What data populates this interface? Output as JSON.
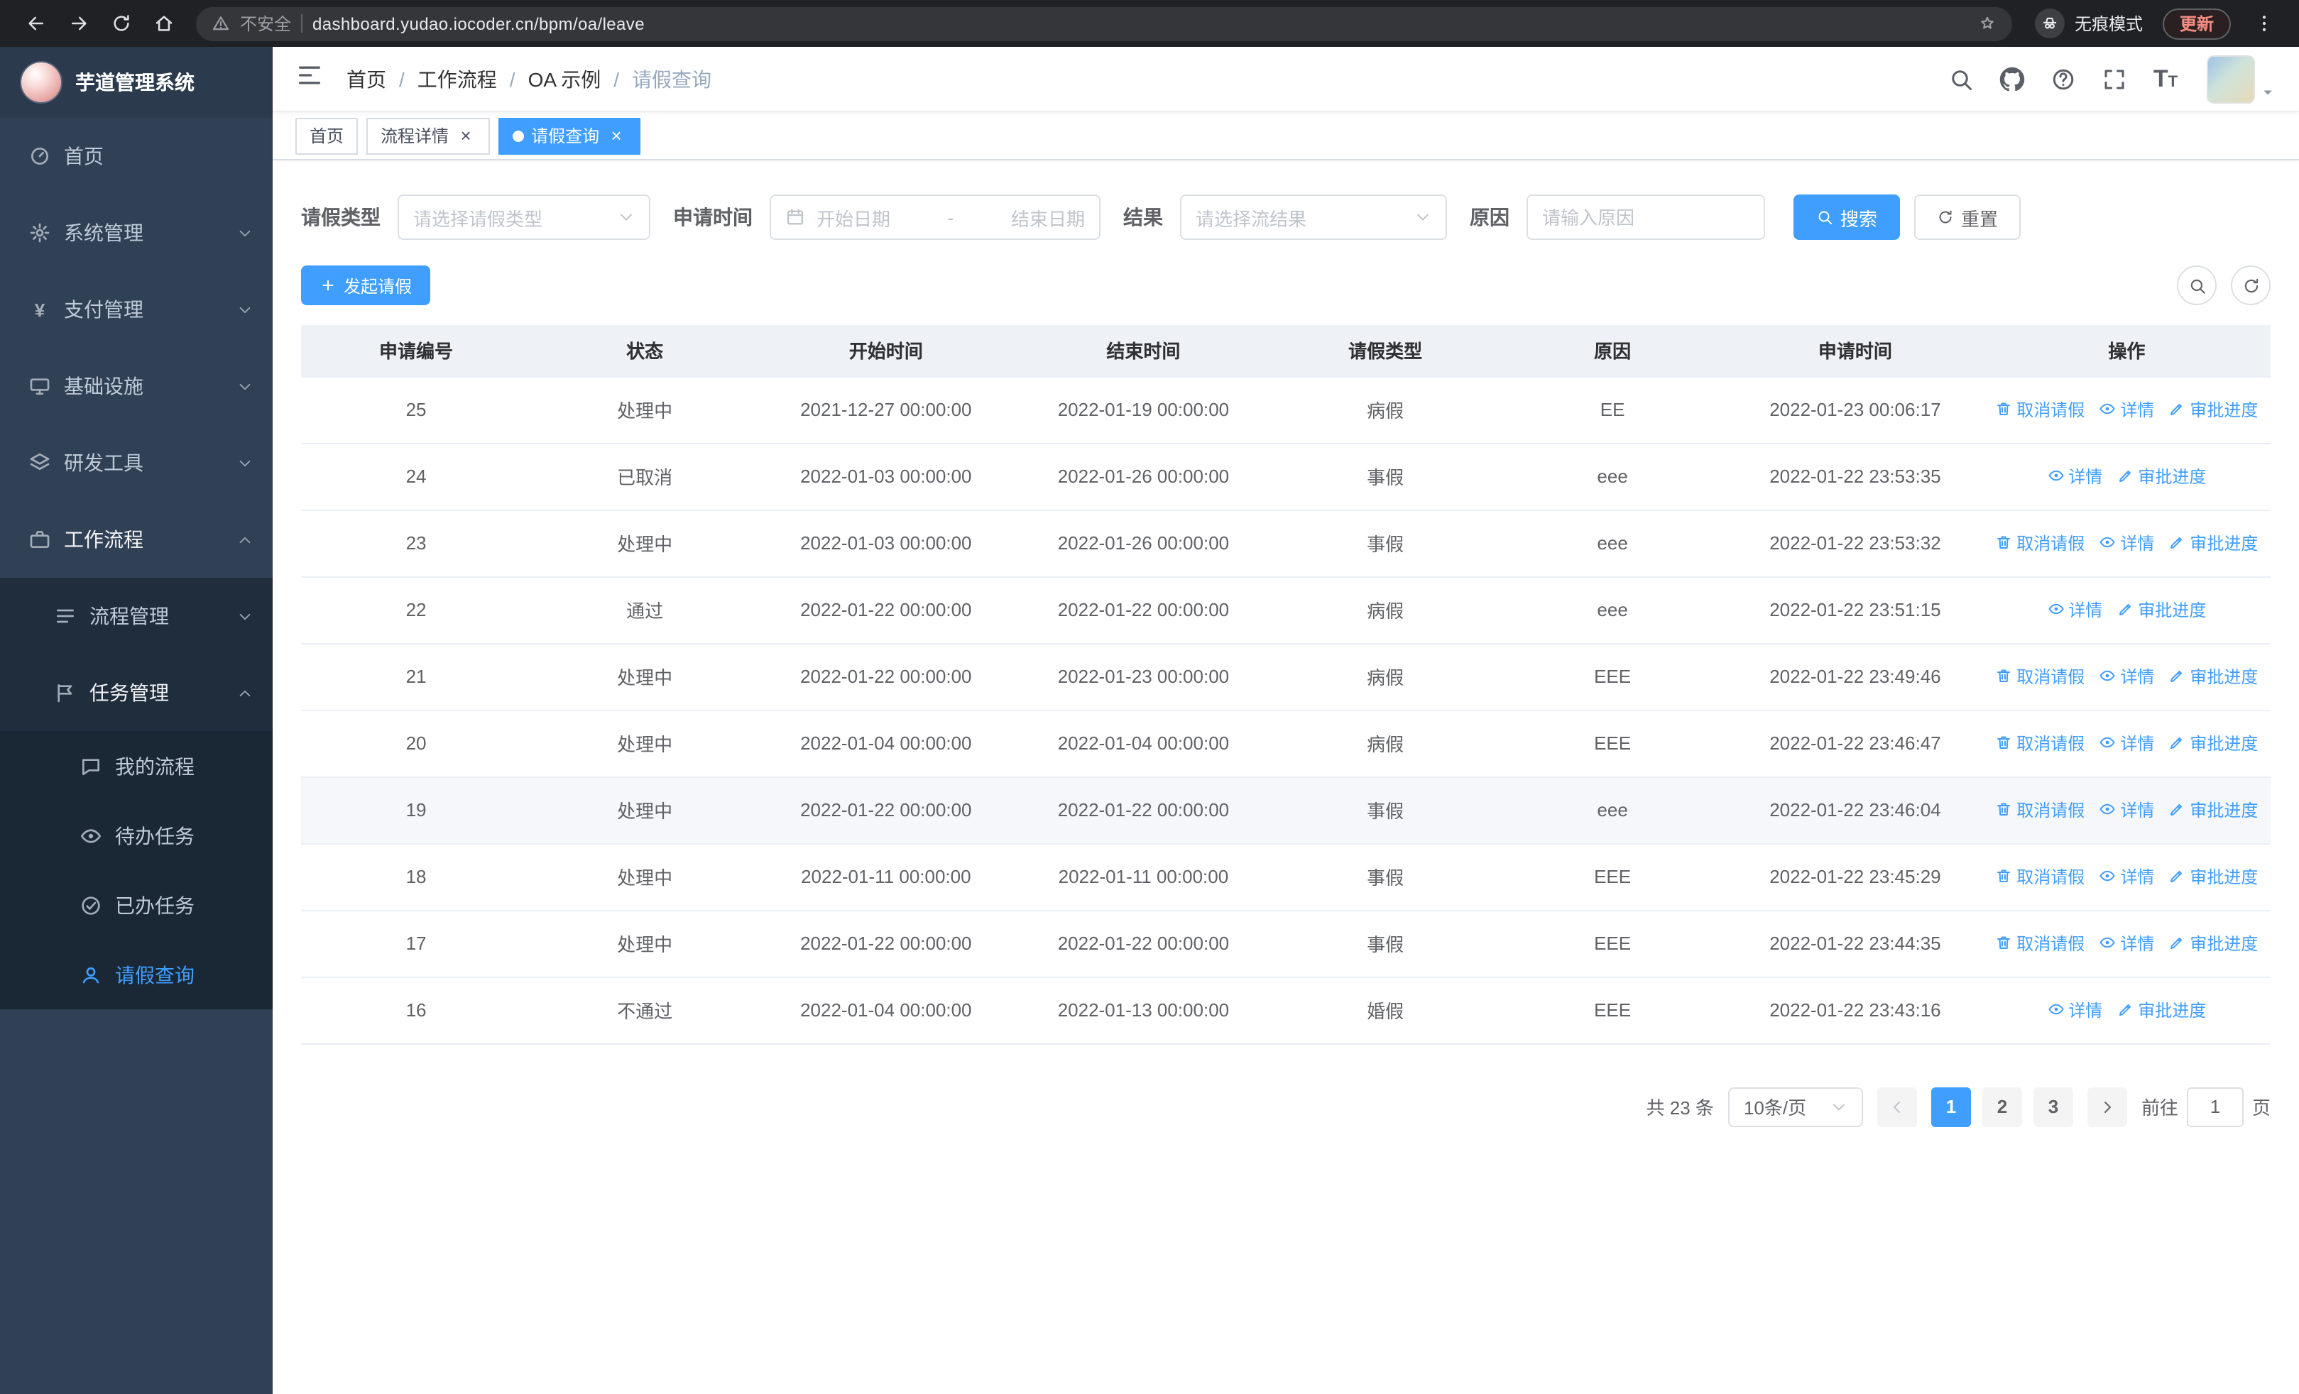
{
  "colors": {
    "accent": "#409EFF",
    "sidebar_bg": "#304156"
  },
  "browser": {
    "security_label": "不安全",
    "url": "dashboard.yudao.iocoder.cn/bpm/oa/leave",
    "incognito_label": "无痕模式",
    "update_label": "更新"
  },
  "sidebar": {
    "logo_title": "芋道管理系统",
    "items": [
      {
        "id": "home",
        "label": "首页",
        "icon": "dashboard-icon",
        "level": 1
      },
      {
        "id": "system-management",
        "label": "系统管理",
        "icon": "gear-icon",
        "level": 1,
        "chevron": "down"
      },
      {
        "id": "payment-management",
        "label": "支付管理",
        "icon": "yen-icon",
        "level": 1,
        "chevron": "down"
      },
      {
        "id": "infrastructure",
        "label": "基础设施",
        "icon": "monitor-icon",
        "level": 1,
        "chevron": "down"
      },
      {
        "id": "dev-tools",
        "label": "研发工具",
        "icon": "tools-icon",
        "level": 1,
        "chevron": "down"
      },
      {
        "id": "workflow",
        "label": "工作流程",
        "icon": "briefcase-icon",
        "level": 1,
        "chevron": "up",
        "expanded": true
      },
      {
        "id": "process-management",
        "label": "流程管理",
        "icon": "list-icon",
        "level": 2,
        "chevron": "down"
      },
      {
        "id": "task-management",
        "label": "任务管理",
        "icon": "flag-icon",
        "level": 2,
        "chevron": "up",
        "expanded": true
      },
      {
        "id": "my-process",
        "label": "我的流程",
        "icon": "chat-icon",
        "level": 3
      },
      {
        "id": "todo-task",
        "label": "待办任务",
        "icon": "eye-icon",
        "level": 3
      },
      {
        "id": "done-task",
        "label": "已办任务",
        "icon": "check-icon",
        "level": 3
      },
      {
        "id": "leave-query",
        "label": "请假查询",
        "icon": "user-icon",
        "level": 3,
        "active": true
      }
    ]
  },
  "navbar": {
    "breadcrumb": [
      "首页",
      "工作流程",
      "OA 示例",
      "请假查询"
    ],
    "action_icons": [
      "search-icon",
      "github-icon",
      "question-icon",
      "fullscreen-icon",
      "font-size-icon"
    ]
  },
  "tabs": [
    {
      "label": "首页"
    },
    {
      "label": "流程详情",
      "closable": true
    },
    {
      "label": "请假查询",
      "closable": true,
      "active": true
    }
  ],
  "filters": {
    "leave_type_label": "请假类型",
    "leave_type_placeholder": "请选择请假类型",
    "apply_time_label": "申请时间",
    "date_start_placeholder": "开始日期",
    "date_separator": "-",
    "date_end_placeholder": "结束日期",
    "result_label": "结果",
    "result_placeholder": "请选择流结果",
    "reason_label": "原因",
    "reason_placeholder": "请输入原因",
    "search_label": "搜索",
    "reset_label": "重置"
  },
  "toolbar": {
    "create_label": "发起请假",
    "icon_buttons": [
      "search-icon",
      "refresh-icon"
    ]
  },
  "table": {
    "columns": [
      "申请编号",
      "状态",
      "开始时间",
      "结束时间",
      "请假类型",
      "原因",
      "申请时间",
      "操作"
    ],
    "action_labels": {
      "cancel": "取消请假",
      "detail": "详情",
      "progress": "审批进度"
    },
    "rows": [
      {
        "id": "25",
        "status": "处理中",
        "start": "2021-12-27 00:00:00",
        "end": "2022-01-19 00:00:00",
        "type": "病假",
        "reason": "EE",
        "applied": "2022-01-23 00:06:17",
        "actions": [
          "cancel",
          "detail",
          "progress"
        ]
      },
      {
        "id": "24",
        "status": "已取消",
        "start": "2022-01-03 00:00:00",
        "end": "2022-01-26 00:00:00",
        "type": "事假",
        "reason": "eee",
        "applied": "2022-01-22 23:53:35",
        "actions": [
          "detail",
          "progress"
        ]
      },
      {
        "id": "23",
        "status": "处理中",
        "start": "2022-01-03 00:00:00",
        "end": "2022-01-26 00:00:00",
        "type": "事假",
        "reason": "eee",
        "applied": "2022-01-22 23:53:32",
        "actions": [
          "cancel",
          "detail",
          "progress"
        ]
      },
      {
        "id": "22",
        "status": "通过",
        "start": "2022-01-22 00:00:00",
        "end": "2022-01-22 00:00:00",
        "type": "病假",
        "reason": "eee",
        "applied": "2022-01-22 23:51:15",
        "actions": [
          "detail",
          "progress"
        ]
      },
      {
        "id": "21",
        "status": "处理中",
        "start": "2022-01-22 00:00:00",
        "end": "2022-01-23 00:00:00",
        "type": "病假",
        "reason": "EEE",
        "applied": "2022-01-22 23:49:46",
        "actions": [
          "cancel",
          "detail",
          "progress"
        ]
      },
      {
        "id": "20",
        "status": "处理中",
        "start": "2022-01-04 00:00:00",
        "end": "2022-01-04 00:00:00",
        "type": "病假",
        "reason": "EEE",
        "applied": "2022-01-22 23:46:47",
        "actions": [
          "cancel",
          "detail",
          "progress"
        ]
      },
      {
        "id": "19",
        "status": "处理中",
        "start": "2022-01-22 00:00:00",
        "end": "2022-01-22 00:00:00",
        "type": "事假",
        "reason": "eee",
        "applied": "2022-01-22 23:46:04",
        "actions": [
          "cancel",
          "detail",
          "progress"
        ],
        "highlight": true
      },
      {
        "id": "18",
        "status": "处理中",
        "start": "2022-01-11 00:00:00",
        "end": "2022-01-11 00:00:00",
        "type": "事假",
        "reason": "EEE",
        "applied": "2022-01-22 23:45:29",
        "actions": [
          "cancel",
          "detail",
          "progress"
        ]
      },
      {
        "id": "17",
        "status": "处理中",
        "start": "2022-01-22 00:00:00",
        "end": "2022-01-22 00:00:00",
        "type": "事假",
        "reason": "EEE",
        "applied": "2022-01-22 23:44:35",
        "actions": [
          "cancel",
          "detail",
          "progress"
        ]
      },
      {
        "id": "16",
        "status": "不通过",
        "start": "2022-01-04 00:00:00",
        "end": "2022-01-13 00:00:00",
        "type": "婚假",
        "reason": "EEE",
        "applied": "2022-01-22 23:43:16",
        "actions": [
          "detail",
          "progress"
        ]
      }
    ]
  },
  "pagination": {
    "total_text": "共 23 条",
    "page_size_text": "10条/页",
    "pages": [
      "1",
      "2",
      "3"
    ],
    "active_page": "1",
    "goto_label": "前往",
    "goto_value": "1",
    "goto_suffix": "页"
  }
}
